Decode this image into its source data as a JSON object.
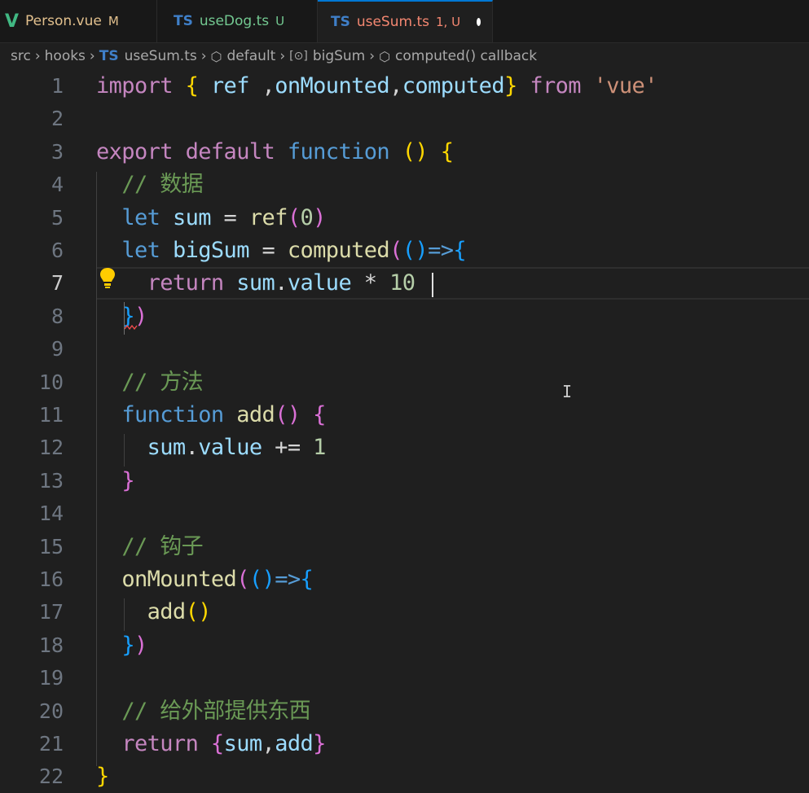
{
  "tabs": [
    {
      "icon": "vue",
      "glyph": "V",
      "label": "Person.vue",
      "badge": "M",
      "label_color": "#e2c08d",
      "badge_color": "#e2c08d"
    },
    {
      "icon": "ts",
      "glyph": "TS",
      "label": "useDog.ts",
      "badge": "U",
      "label_color": "#73c991",
      "badge_color": "#73c991"
    },
    {
      "icon": "ts",
      "glyph": "TS",
      "label": "useSum.ts",
      "badge": "1, U",
      "label_color": "#f48771",
      "badge_color": "#f48771",
      "active": true,
      "unsaved": true
    }
  ],
  "breadcrumb": {
    "src": "src",
    "hooks": "hooks",
    "file_glyph": "TS",
    "file": "useSum.ts",
    "default": "default",
    "var_glyph": "[⊙]",
    "bigSum": "bigSum",
    "callback": "computed() callback"
  },
  "editor": {
    "current_line": 7,
    "line_numbers": [
      "1",
      "2",
      "3",
      "4",
      "5",
      "6",
      "7",
      "8",
      "9",
      "10",
      "11",
      "12",
      "13",
      "14",
      "15",
      "16",
      "17",
      "18",
      "19",
      "20",
      "21",
      "22"
    ],
    "lines": [
      [
        [
          "kw",
          "import"
        ],
        [
          "pl",
          " "
        ],
        [
          "b1",
          "{"
        ],
        [
          "pl",
          " "
        ],
        [
          "va",
          "ref"
        ],
        [
          "pl",
          " ,"
        ],
        [
          "va",
          "onMounted"
        ],
        [
          "pl",
          ","
        ],
        [
          "va",
          "computed"
        ],
        [
          "b1",
          "}"
        ],
        [
          "pl",
          " "
        ],
        [
          "kw",
          "from"
        ],
        [
          "pl",
          " "
        ],
        [
          "str",
          "'vue'"
        ]
      ],
      [],
      [
        [
          "kw",
          "export"
        ],
        [
          "pl",
          " "
        ],
        [
          "kw",
          "default"
        ],
        [
          "pl",
          " "
        ],
        [
          "sk",
          "function"
        ],
        [
          "pl",
          " "
        ],
        [
          "b1",
          "()"
        ],
        [
          "pl",
          " "
        ],
        [
          "b1",
          "{"
        ]
      ],
      [
        [
          "pl",
          "  "
        ],
        [
          "cm",
          "// 数据"
        ]
      ],
      [
        [
          "pl",
          "  "
        ],
        [
          "sk",
          "let"
        ],
        [
          "pl",
          " "
        ],
        [
          "va",
          "sum"
        ],
        [
          "pl",
          " = "
        ],
        [
          "fn",
          "ref"
        ],
        [
          "b2",
          "("
        ],
        [
          "num",
          "0"
        ],
        [
          "b2",
          ")"
        ]
      ],
      [
        [
          "pl",
          "  "
        ],
        [
          "sk",
          "let"
        ],
        [
          "pl",
          " "
        ],
        [
          "va",
          "bigSum"
        ],
        [
          "pl",
          " = "
        ],
        [
          "fn",
          "computed"
        ],
        [
          "b2",
          "("
        ],
        [
          "b3",
          "()"
        ],
        [
          "sk",
          "=>"
        ],
        [
          "b3",
          "{"
        ]
      ],
      [
        [
          "pl",
          "    "
        ],
        [
          "kw",
          "return"
        ],
        [
          "pl",
          " "
        ],
        [
          "va",
          "sum"
        ],
        [
          "pl",
          "."
        ],
        [
          "va",
          "value"
        ],
        [
          "pl",
          " * "
        ],
        [
          "num",
          "10"
        ]
      ],
      [
        [
          "pl",
          "  "
        ],
        [
          "b3",
          "}"
        ],
        [
          "b2",
          ")"
        ]
      ],
      [],
      [
        [
          "pl",
          "  "
        ],
        [
          "cm",
          "// 方法"
        ]
      ],
      [
        [
          "pl",
          "  "
        ],
        [
          "sk",
          "function"
        ],
        [
          "pl",
          " "
        ],
        [
          "fn",
          "add"
        ],
        [
          "b2",
          "()"
        ],
        [
          "pl",
          " "
        ],
        [
          "b2",
          "{"
        ]
      ],
      [
        [
          "pl",
          "    "
        ],
        [
          "va",
          "sum"
        ],
        [
          "pl",
          "."
        ],
        [
          "va",
          "value"
        ],
        [
          "pl",
          " += "
        ],
        [
          "num",
          "1"
        ]
      ],
      [
        [
          "pl",
          "  "
        ],
        [
          "b2",
          "}"
        ]
      ],
      [],
      [
        [
          "pl",
          "  "
        ],
        [
          "cm",
          "// 钩子"
        ]
      ],
      [
        [
          "pl",
          "  "
        ],
        [
          "fn",
          "onMounted"
        ],
        [
          "b2",
          "("
        ],
        [
          "b3",
          "()"
        ],
        [
          "sk",
          "=>"
        ],
        [
          "b3",
          "{"
        ]
      ],
      [
        [
          "pl",
          "    "
        ],
        [
          "fn",
          "add"
        ],
        [
          "b1",
          "()"
        ]
      ],
      [
        [
          "pl",
          "  "
        ],
        [
          "b3",
          "}"
        ],
        [
          "b2",
          ")"
        ]
      ],
      [],
      [
        [
          "pl",
          "  "
        ],
        [
          "cm",
          "// 给外部提供东西"
        ]
      ],
      [
        [
          "pl",
          "  "
        ],
        [
          "kw",
          "return"
        ],
        [
          "pl",
          " "
        ],
        [
          "b2",
          "{"
        ],
        [
          "va",
          "sum"
        ],
        [
          "pl",
          ","
        ],
        [
          "va",
          "add"
        ],
        [
          "b2",
          "}"
        ]
      ],
      [
        [
          "b1",
          "}"
        ]
      ]
    ]
  },
  "colors": {
    "background": "#1f1f1f",
    "tabbar": "#181818",
    "active_tab_border": "#0078d4",
    "lightbulb": "#ffcc00"
  }
}
